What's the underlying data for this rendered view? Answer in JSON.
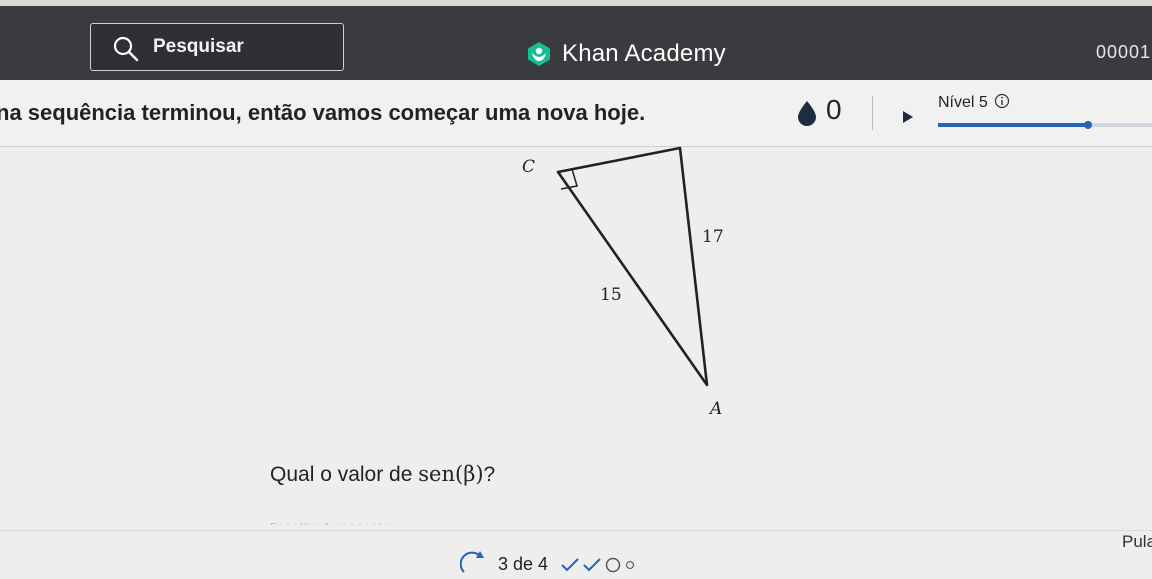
{
  "nav": {
    "search_label": "Pesquisar",
    "brand_name": "Khan Academy",
    "counter": "00001"
  },
  "header": {
    "message": "na sequência terminou, então vamos começar uma nova hoje.",
    "points": "0",
    "level_label": "Nível 5",
    "level_progress": 0.7
  },
  "figure": {
    "vertex_c": "C",
    "vertex_a": "A",
    "side_hypotenuse": "17",
    "side_leg": "15"
  },
  "question": {
    "prefix": "Qual o valor de ",
    "expression": "sen(β)",
    "suffix": "?"
  },
  "footer": {
    "faint_text": "Escolha 1 resposta:",
    "skip_label": "Pula",
    "progress_label": "3 de 4"
  },
  "colors": {
    "nav_bg": "#3a3b3e",
    "accent": "#2563b8",
    "check_color": "#2563b8"
  }
}
